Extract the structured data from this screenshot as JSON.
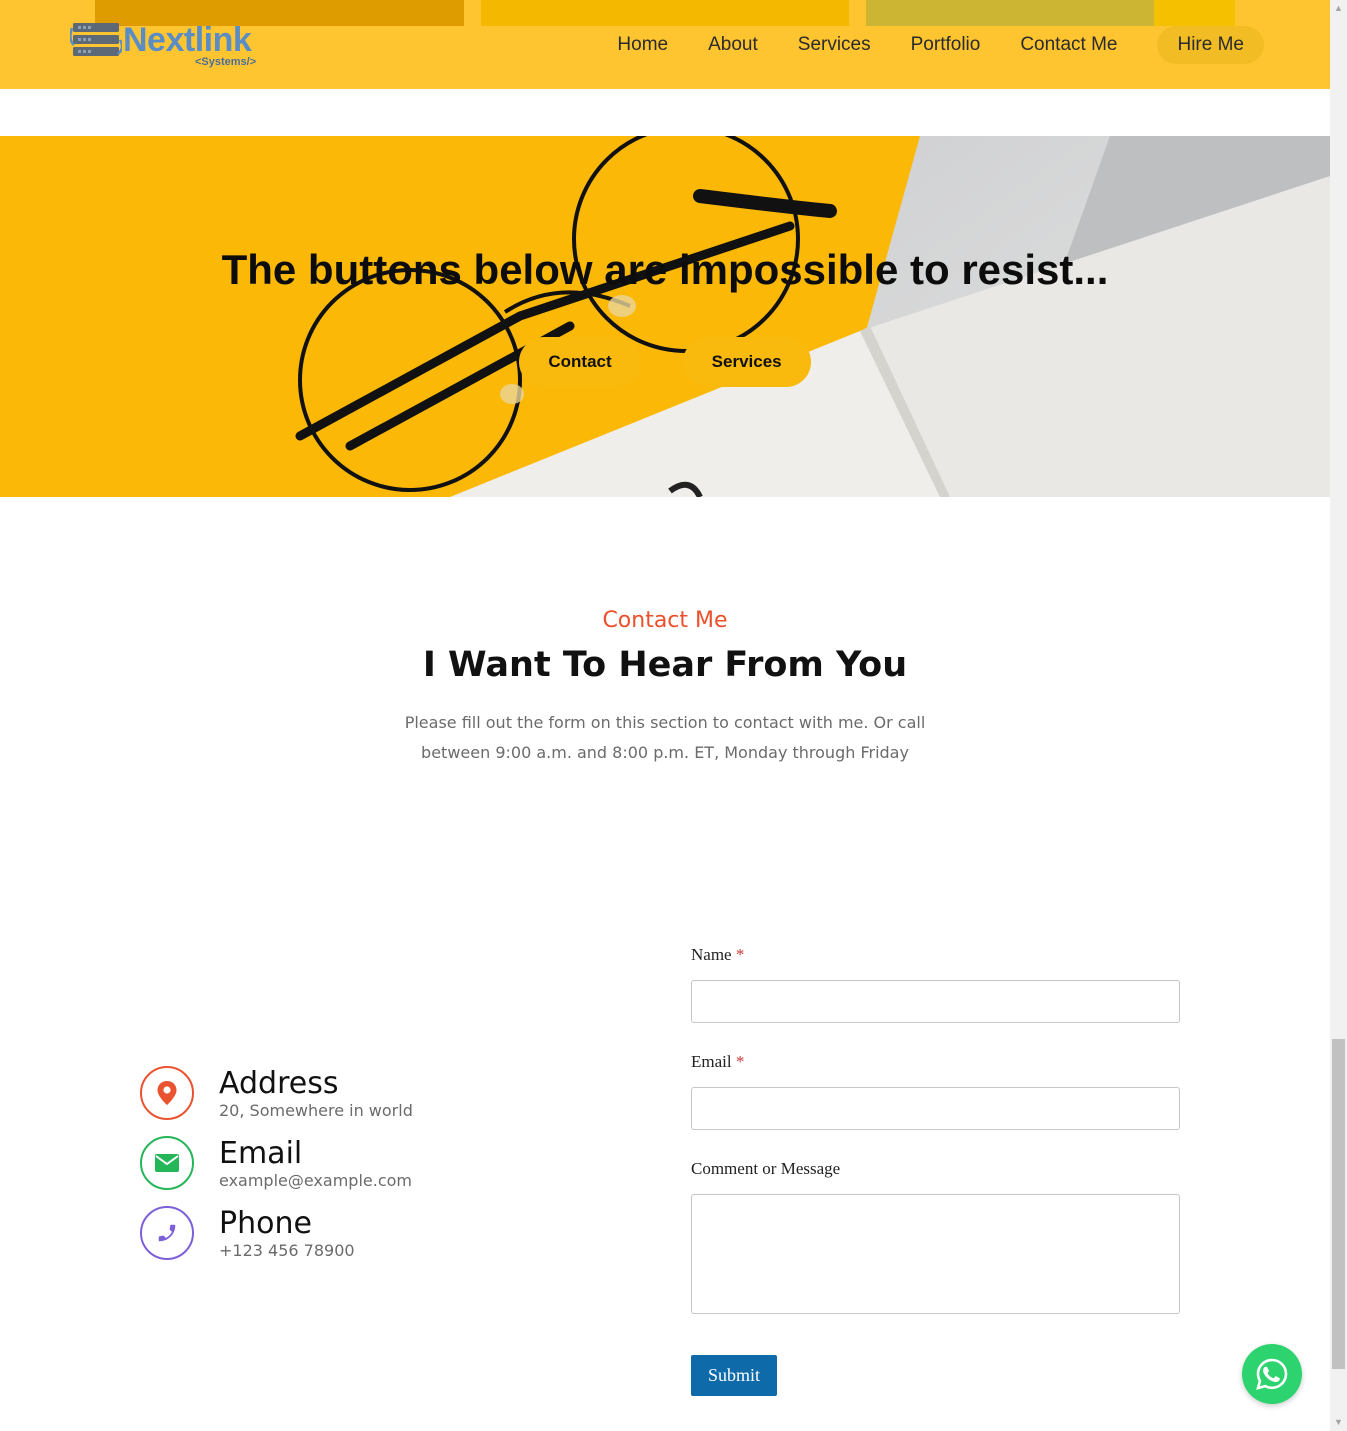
{
  "brand": {
    "name": "Nextlink",
    "tagline": "<Systems/>",
    "colors": {
      "header": "#ffc530",
      "accent": "#ec4f2b",
      "logo": "#5a8dc6"
    }
  },
  "nav": {
    "items": [
      "Home",
      "About",
      "Services",
      "Portfolio",
      "Contact Me"
    ],
    "cta": "Hire Me"
  },
  "hero": {
    "title": "The buttons below are impossible to resist...",
    "buttons": [
      "Contact",
      "Services"
    ]
  },
  "contact": {
    "eyebrow": "Contact Me",
    "heading": "I Want To Hear From You",
    "lead": "Please fill out the form on this section to contact with me. Or call between 9:00 a.m. and 8:00 p.m. ET, Monday through Friday",
    "info": [
      {
        "title": "Address",
        "value": "20, Somewhere in world",
        "icon": "map-pin-icon",
        "color": "#e9532f"
      },
      {
        "title": "Email",
        "value": "example@example.com",
        "icon": "envelope-icon",
        "color": "#26b65a"
      },
      {
        "title": "Phone",
        "value": "+123 456 78900",
        "icon": "phone-icon",
        "color": "#7d5fd9"
      }
    ]
  },
  "form": {
    "name_label": "Name",
    "email_label": "Email",
    "message_label": "Comment or Message",
    "required_mark": "*",
    "name_value": "",
    "email_value": "",
    "message_value": "",
    "submit": "Submit"
  },
  "widgets": {
    "whatsapp_icon": "whatsapp-icon",
    "whatsapp_color": "#2dd36e"
  }
}
